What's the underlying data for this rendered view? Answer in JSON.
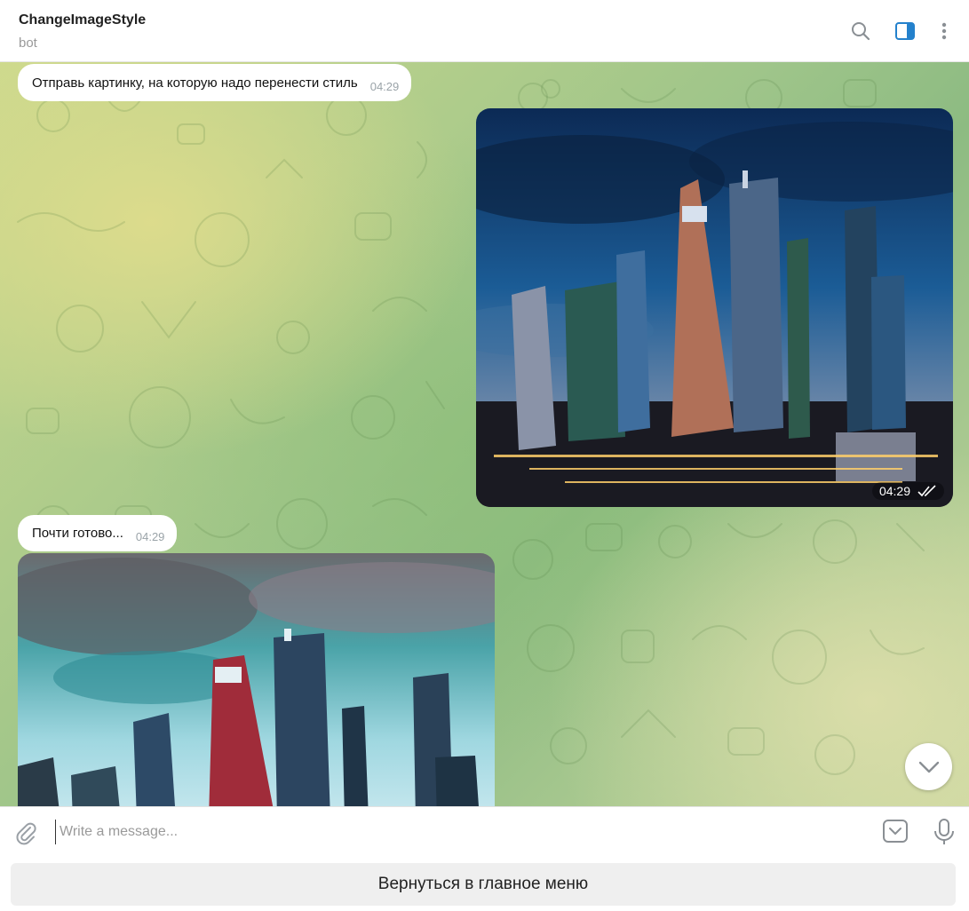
{
  "header": {
    "title": "ChangeImageStyle",
    "status": "bot",
    "accent_color": "#2481cc"
  },
  "messages": [
    {
      "type": "text",
      "side": "incoming",
      "text": "Отправь картинку, на которую надо перенести стиль",
      "time": "04:29"
    },
    {
      "type": "photo",
      "side": "outgoing",
      "time": "04:29",
      "read_status": "double-check-icon"
    },
    {
      "type": "text",
      "side": "incoming",
      "text": "Почти готово...",
      "time": "04:29"
    },
    {
      "type": "photo",
      "side": "incoming",
      "time": ""
    }
  ],
  "composer": {
    "placeholder": "Write a message..."
  },
  "reply_keyboard": {
    "button_label": "Вернуться в главное меню"
  }
}
